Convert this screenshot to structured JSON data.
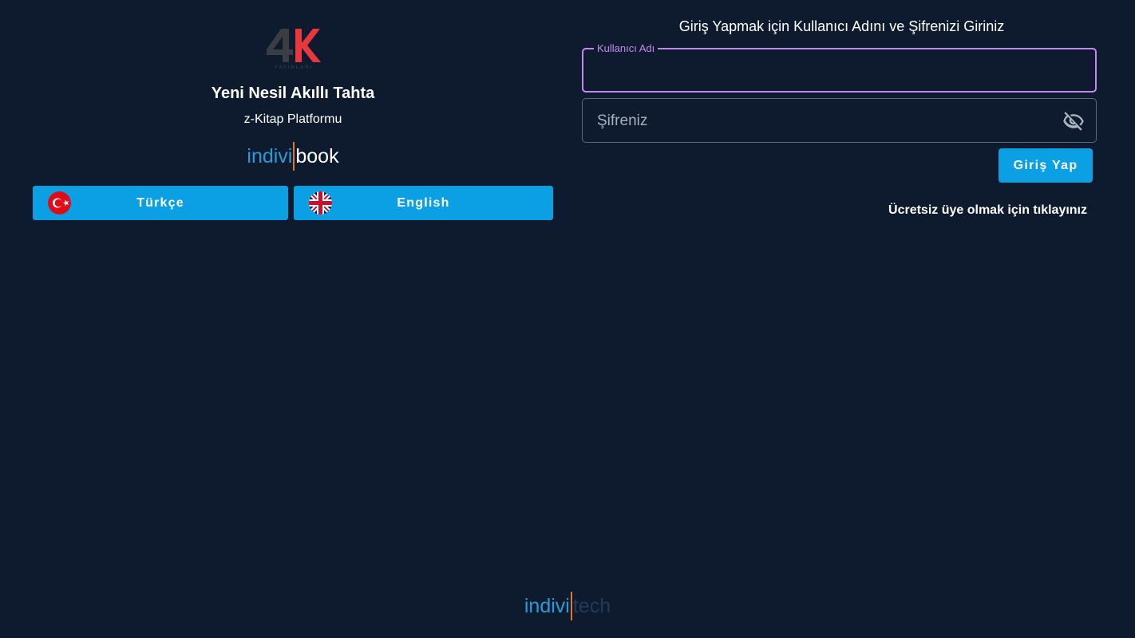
{
  "left_panel": {
    "logo": {
      "mark": "4K",
      "subtitle": "YAYINLARI",
      "colors": {
        "four": "#3b3d42",
        "k": "#e8383d"
      }
    },
    "title": "Yeni Nesil Akıllı Tahta",
    "subtitle": "z-Kitap Platformu",
    "indivibook": {
      "part1": "indivi",
      "part2": "book"
    },
    "languages": [
      {
        "label": "Türkçe",
        "flag_icon": "turkey-flag-icon"
      },
      {
        "label": "English",
        "flag_icon": "uk-flag-icon"
      }
    ]
  },
  "login": {
    "heading": "Giriş Yapmak için Kullanıcı Adını ve Şifrenizi Giriniz",
    "username": {
      "label": "Kullanıcı Adı",
      "value": ""
    },
    "password": {
      "placeholder": "Şifreniz",
      "value": "",
      "toggle_icon": "eye-off-icon"
    },
    "submit_label": "Giriş Yap",
    "signup_text": "Ücretsiz üye olmak için tıklayınız"
  },
  "footer": {
    "part1": "indivi",
    "part2": "tech"
  },
  "colors": {
    "background": "#0e1b2e",
    "accent_button": "#0aa0e3",
    "focus_outline": "#c68aef",
    "brand_blue": "#2b9ad6",
    "brand_orange": "#e8742a"
  }
}
